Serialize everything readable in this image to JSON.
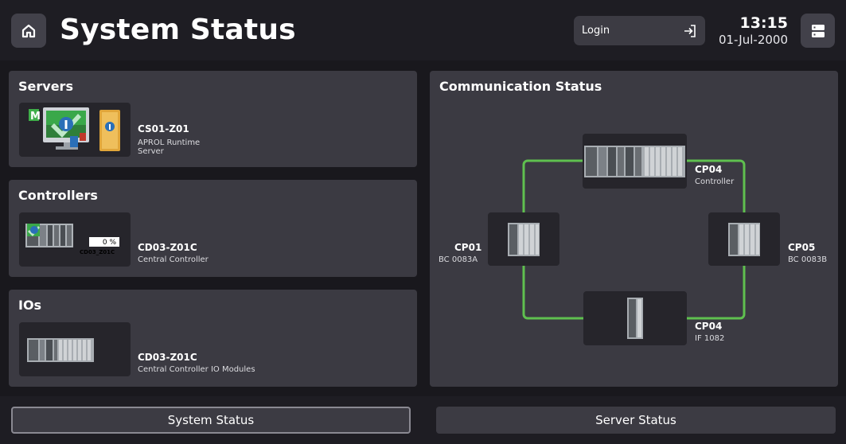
{
  "header": {
    "title": "System Status",
    "login_label": "Login",
    "time": "13:15",
    "date": "01-Jul-2000"
  },
  "servers": {
    "title": "Servers",
    "device_name": "CS01-Z01",
    "device_desc_line1": "APROL Runtime",
    "device_desc_line2": "Server",
    "badge": "M"
  },
  "controllers": {
    "title": "Controllers",
    "device_name": "CD03-Z01C",
    "device_desc": "Central Controller",
    "load_percent": "0 %",
    "thumb_caption": "CD03_Z01C"
  },
  "ios": {
    "title": "IOs",
    "device_name": "CD03-Z01C",
    "device_desc": "Central Controller IO Modules"
  },
  "communication": {
    "title": "Communication Status",
    "link_color": "#5fc04f",
    "nodes": [
      {
        "name": "CP04",
        "desc": "Controller"
      },
      {
        "name": "CP01",
        "desc": "BC 0083A"
      },
      {
        "name": "CP05",
        "desc": "BC 0083B"
      },
      {
        "name": "CP04",
        "desc": "IF 1082"
      }
    ]
  },
  "footer": {
    "system_status_label": "System Status",
    "server_status_label": "Server Status"
  }
}
